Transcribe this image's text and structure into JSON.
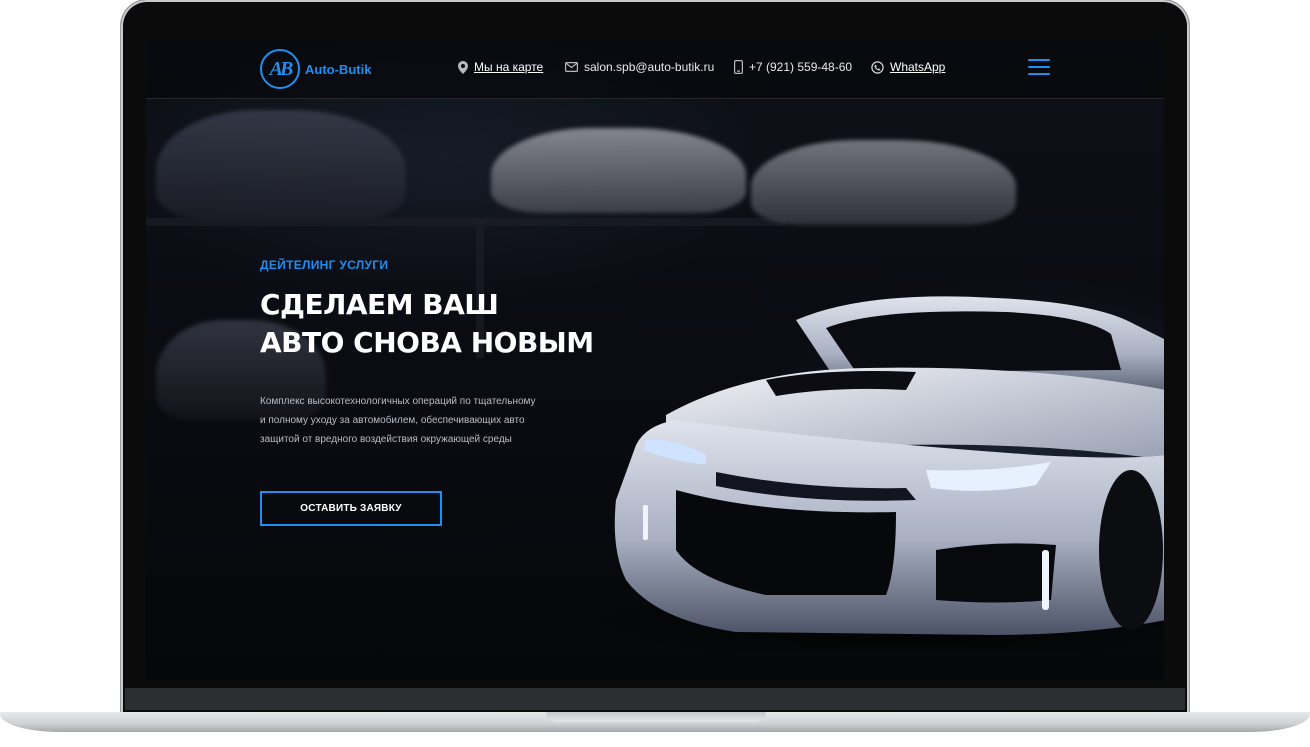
{
  "header": {
    "logo_mark": "AB",
    "logo_text": "Auto-Butik",
    "map_link": "Мы на карте",
    "email": "salon.spb@auto-butik.ru",
    "phone": "+7 (921) 559-48-60",
    "whatsapp": "WhatsApp",
    "icons": [
      "map-pin-icon",
      "mail-icon",
      "phone-icon",
      "whatsapp-icon",
      "menu-icon"
    ]
  },
  "hero": {
    "eyebrow": "ДЕЙТЕЛИНГ УСЛУГИ",
    "title_line1": "СДЕЛАЕМ ВАШ",
    "title_line2": "АВТО СНОВА НОВЫМ",
    "description_line1": "Комплекс высокотехнологичных операций по тщательному",
    "description_line2": "и полному уходу за автомобилем, обеспечивающих авто",
    "description_line3": "защитой от вредного воздействия окружающей среды",
    "cta_label": "ОСТАВИТЬ ЗАЯВКУ"
  },
  "colors": {
    "accent": "#1e8ff0",
    "background": "#07090d",
    "text": "#ffffff"
  }
}
